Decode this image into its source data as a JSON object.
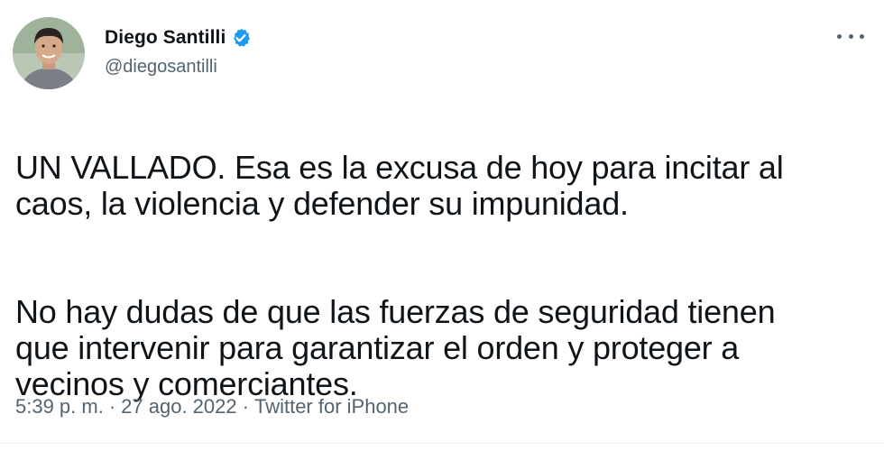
{
  "author": {
    "display_name": "Diego Santilli",
    "handle": "@diegosantilli",
    "verified": true,
    "avatar_icon": "profile-photo"
  },
  "tweet": {
    "paragraph_1": "UN VALLADO. Esa es la excusa de hoy para incitar al\ncaos, la violencia y defender su impunidad.",
    "paragraph_2": "No hay dudas de que las fuerzas de seguridad tienen\nque intervenir para garantizar el orden y proteger a\nvecinos y comerciantes."
  },
  "meta": {
    "time": "5:39 p. m.",
    "separator": "·",
    "date": "27 ago. 2022",
    "source": "Twitter for iPhone"
  },
  "colors": {
    "verified_badge": "#1d9bf0",
    "text_primary": "#0f1419",
    "text_secondary": "#536471"
  },
  "icons": {
    "more": "more-options-icon",
    "verified": "verified-badge-icon"
  }
}
